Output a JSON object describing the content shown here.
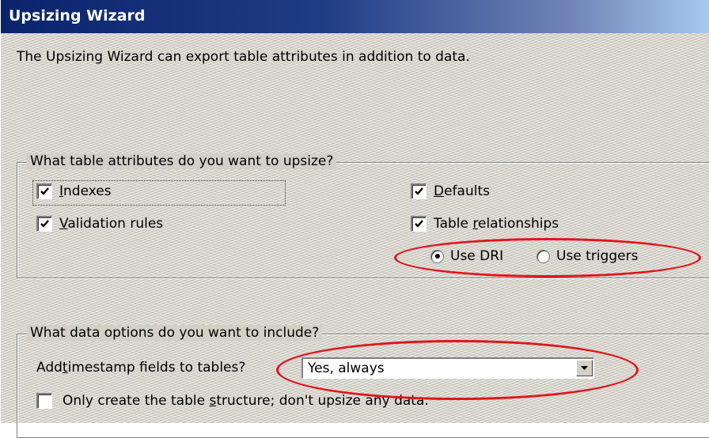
{
  "window": {
    "title": "Upsizing Wizard"
  },
  "intro_text": "The Upsizing Wizard can export table attributes in addition to data.",
  "attributes_group": {
    "legend": "What table attributes do you want to upsize?",
    "indexes": {
      "label_mnemonic": "I",
      "label_rest": "ndexes",
      "checked": true
    },
    "validation_rules": {
      "label_mnemonic": "V",
      "label_rest": "alidation rules",
      "checked": true
    },
    "defaults": {
      "label_mnemonic": "D",
      "label_rest": "efaults",
      "checked": true
    },
    "table_relationships": {
      "label_before": "Table ",
      "label_mnemonic": "r",
      "label_after": "elationships",
      "checked": true
    },
    "use_dri": {
      "label": "Use DRI",
      "selected": true
    },
    "use_triggers": {
      "label": "Use triggers",
      "selected": false
    }
  },
  "data_group": {
    "legend": "What data options do you want to include?",
    "timestamp_label_before": "Add ",
    "timestamp_label_mnemonic": "t",
    "timestamp_label_after": "imestamp fields to tables?",
    "timestamp_value": "Yes, always",
    "structure_only": {
      "label_before": "Only create the table ",
      "label_mnemonic": "s",
      "label_after": "tructure; don't upsize any data.",
      "checked": false
    }
  },
  "colors": {
    "highlight_ellipse": "#e0141a",
    "titlebar": "#0a246a",
    "dialog_face": "#d4d0c8"
  }
}
